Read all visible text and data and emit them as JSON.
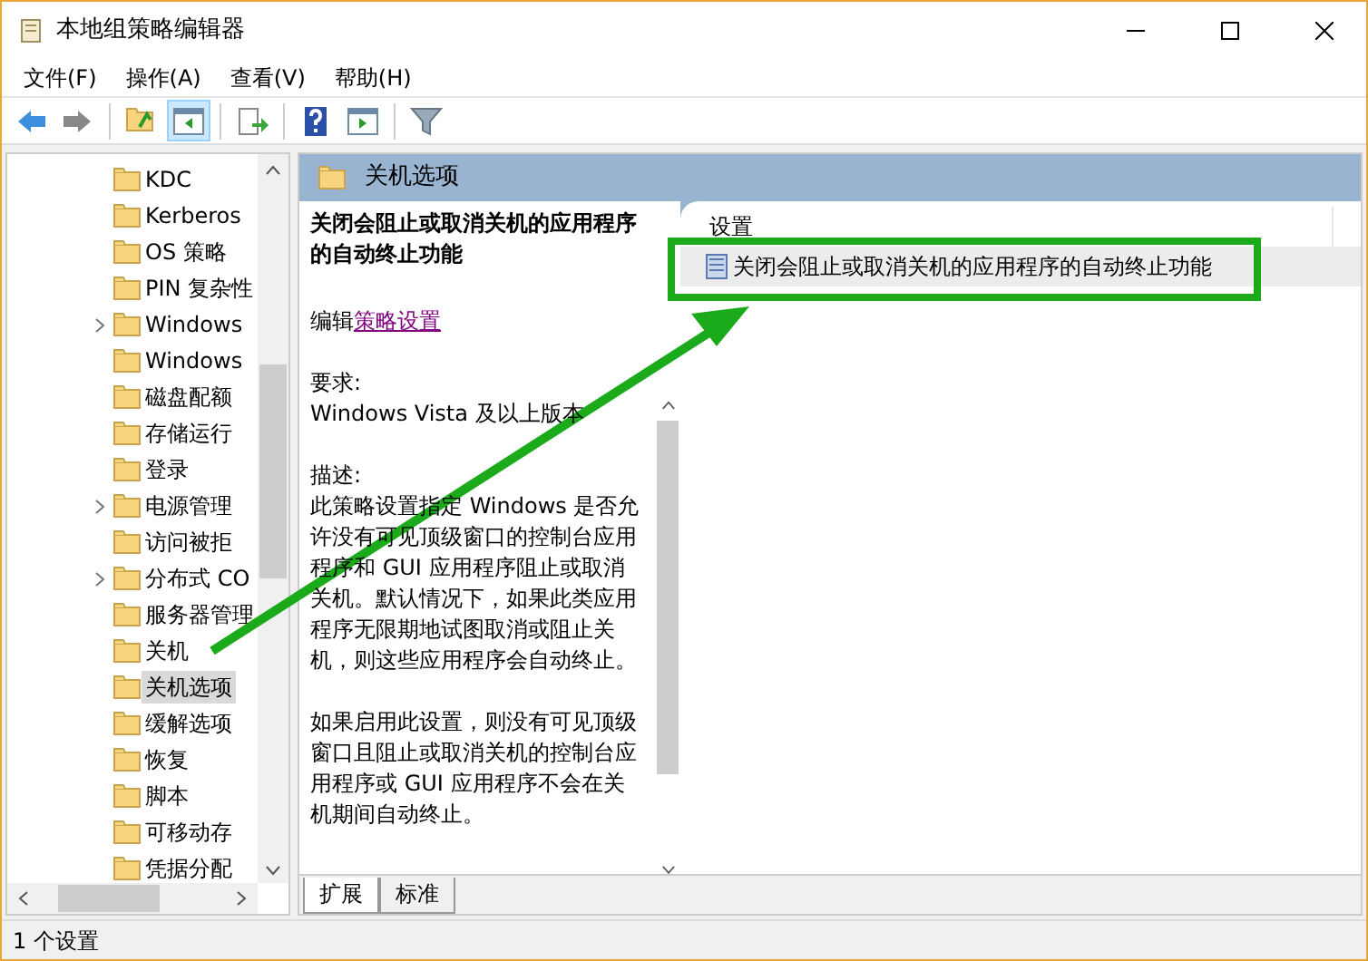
{
  "window": {
    "title": "本地组策略编辑器"
  },
  "menu": [
    "文件(F)",
    "操作(A)",
    "查看(V)",
    "帮助(H)"
  ],
  "toolbar": [
    {
      "kind": "back",
      "pressed": false
    },
    {
      "kind": "forward",
      "pressed": false
    },
    {
      "kind": "sep"
    },
    {
      "kind": "up",
      "pressed": false
    },
    {
      "kind": "tree",
      "pressed": true
    },
    {
      "kind": "sep"
    },
    {
      "kind": "export",
      "pressed": false
    },
    {
      "kind": "sep"
    },
    {
      "kind": "help",
      "pressed": false
    },
    {
      "kind": "pane",
      "pressed": false
    },
    {
      "kind": "sep"
    },
    {
      "kind": "filter",
      "pressed": false
    }
  ],
  "tree": [
    {
      "label": "KDC",
      "expandable": false,
      "selected": false
    },
    {
      "label": "Kerberos",
      "expandable": false,
      "selected": false
    },
    {
      "label": "OS 策略",
      "expandable": false,
      "selected": false
    },
    {
      "label": "PIN 复杂性",
      "expandable": false,
      "selected": false
    },
    {
      "label": "Windows",
      "expandable": true,
      "selected": false
    },
    {
      "label": "Windows",
      "expandable": false,
      "selected": false
    },
    {
      "label": "磁盘配额",
      "expandable": false,
      "selected": false
    },
    {
      "label": "存储运行",
      "expandable": false,
      "selected": false
    },
    {
      "label": "登录",
      "expandable": false,
      "selected": false
    },
    {
      "label": "电源管理",
      "expandable": true,
      "selected": false
    },
    {
      "label": "访问被拒",
      "expandable": false,
      "selected": false
    },
    {
      "label": "分布式 CO",
      "expandable": true,
      "selected": false
    },
    {
      "label": "服务器管理",
      "expandable": false,
      "selected": false
    },
    {
      "label": "关机",
      "expandable": false,
      "selected": false
    },
    {
      "label": "关机选项",
      "expandable": false,
      "selected": true
    },
    {
      "label": "缓解选项",
      "expandable": false,
      "selected": false
    },
    {
      "label": "恢复",
      "expandable": false,
      "selected": false
    },
    {
      "label": "脚本",
      "expandable": false,
      "selected": false
    },
    {
      "label": "可移动存",
      "expandable": false,
      "selected": false
    },
    {
      "label": "凭据分配",
      "expandable": false,
      "selected": false
    }
  ],
  "panel": {
    "title": "关机选项",
    "description": {
      "heading": "关闭会阻止或取消关机的应用程序的自动终止功能",
      "edit_prefix": "编辑",
      "edit_link": "策略设置",
      "requirements_label": "要求:",
      "requirements": "Windows Vista 及以上版本",
      "description_label": "描述:",
      "paragraphs": [
        "此策略设置指定 Windows 是否允许没有可见顶级窗口的控制台应用程序和 GUI 应用程序阻止或取消关机。默认情况下，如果此类应用程序无限期地试图取消或阻止关机，则这些应用程序会自动终止。",
        "如果启用此设置，则没有可见顶级窗口且阻止或取消关机的控制台应用程序或 GUI 应用程序不会在关机期间自动终止。"
      ]
    },
    "list": {
      "column": "设置",
      "rows": [
        {
          "label": "关闭会阻止或取消关机的应用程序的自动终止功能",
          "selected": true
        }
      ]
    },
    "tabs": [
      {
        "label": "扩展",
        "selected": true
      },
      {
        "label": "标准",
        "selected": false
      }
    ]
  },
  "status_bar": "1 个设置"
}
